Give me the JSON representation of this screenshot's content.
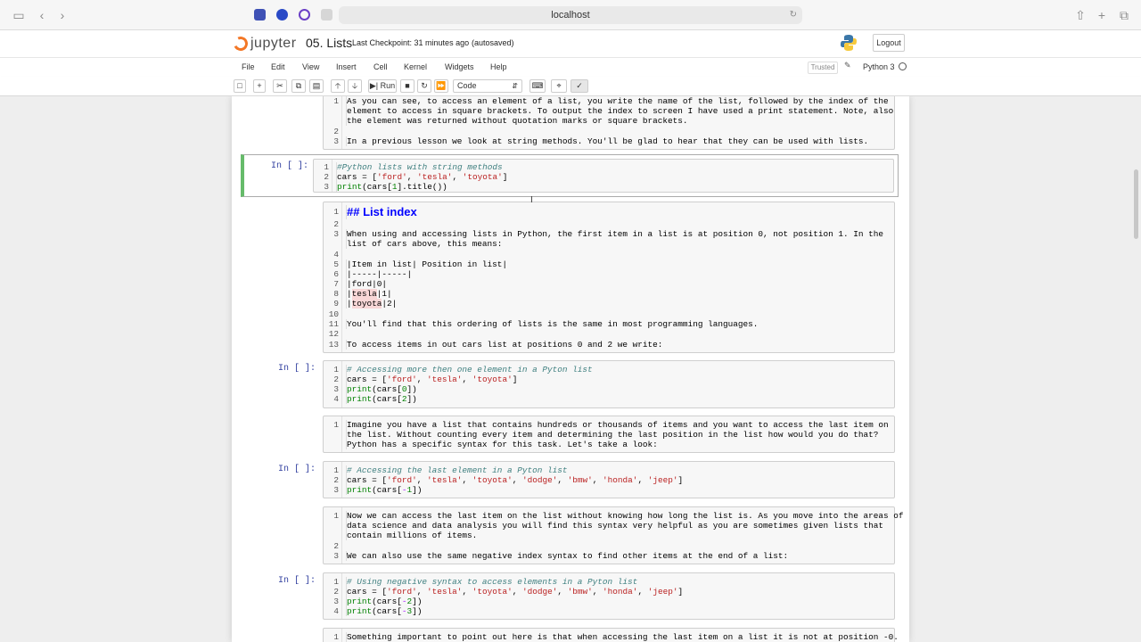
{
  "browser": {
    "url": "localhost"
  },
  "header": {
    "logo_text": "jupyter",
    "notebook_title": "05. Lists",
    "checkpoint": "Last Checkpoint: 31 minutes ago",
    "autosaved": "(autosaved)",
    "logout": "Logout"
  },
  "menubar": {
    "items": [
      "File",
      "Edit",
      "View",
      "Insert",
      "Cell",
      "Kernel",
      "Widgets",
      "Help"
    ],
    "trusted": "Trusted",
    "kernel": "Python 3"
  },
  "toolbar": {
    "run_label": "Run",
    "cell_type": "Code"
  },
  "cells": [
    {
      "type": "markdown",
      "prompt": "",
      "lines": [
        "As you can see, to access an element of a list, you write the name of the list, followed by the index of the",
        "element to access in square brackets. To output the index to screen I have used a print statement. Note, also",
        "the element was returned without quotation marks or square brackets.",
        "",
        "In a previous lesson we look at string methods. You'll be glad to hear that they can be used with lists."
      ],
      "numbers": [
        "1",
        "",
        "",
        "2",
        "3"
      ]
    },
    {
      "type": "code",
      "prompt": "In [ ]:",
      "lines": [
        "#Python lists with string methods",
        "cars = ['ford', 'tesla', 'toyota']",
        "print(cars[1].title())"
      ],
      "numbers": [
        "1",
        "2",
        "3"
      ]
    },
    {
      "type": "markdown",
      "prompt": "",
      "lines": [
        "## List index",
        "",
        "When using and accessing lists in Python, the first item in a list is at position 0, not position 1. In the",
        "list of cars above, this means:",
        "",
        "|Item in list| Position in list|",
        "|-----|-----|",
        "|ford|0|",
        "|tesla|1|",
        "|toyota|2|",
        "",
        "You'll find that this ordering of lists is the same in most programming languages.",
        "",
        "To access items in out cars list at positions 0 and 2 we write:"
      ],
      "numbers": [
        "1",
        "2",
        "3",
        "",
        "4",
        "5",
        "6",
        "7",
        "8",
        "9",
        "10",
        "11",
        "12",
        "13"
      ]
    },
    {
      "type": "code",
      "prompt": "In [ ]:",
      "lines": [
        "# Accessing more then one element in a Pyton list",
        "cars = ['ford', 'tesla', 'toyota']",
        "print(cars[0])",
        "print(cars[2])"
      ],
      "numbers": [
        "1",
        "2",
        "3",
        "4"
      ]
    },
    {
      "type": "markdown",
      "prompt": "",
      "lines": [
        "Imagine you have a list that contains hundreds or thousands of items and you want to access the last item on",
        "the list. Without counting every item and determining the last position in the list how would you do that?",
        "Python has a specific syntax for this task. Let's take a look:"
      ],
      "numbers": [
        "1",
        "",
        ""
      ]
    },
    {
      "type": "code",
      "prompt": "In [ ]:",
      "lines": [
        "# Accessing the last element in a Pyton list",
        "cars = ['ford', 'tesla', 'toyota', 'dodge', 'bmw', 'honda', 'jeep']",
        "print(cars[-1])"
      ],
      "numbers": [
        "1",
        "2",
        "3"
      ]
    },
    {
      "type": "markdown",
      "prompt": "",
      "lines": [
        "Now we can access the last item on the list without knowing how long the list is. As you move into the areas of",
        "data science and data analysis you will find this syntax very helpful as you are sometimes given lists that",
        "contain millions of items.",
        "",
        "We can also use the same negative index syntax to find other items at the end of a list:"
      ],
      "numbers": [
        "1",
        "",
        "",
        "2",
        "3"
      ]
    },
    {
      "type": "code",
      "prompt": "In [ ]:",
      "lines": [
        "# Using negative syntax to access elements in a Pyton list",
        "cars = ['ford', 'tesla', 'toyota', 'dodge', 'bmw', 'honda', 'jeep']",
        "print(cars[-2])",
        "print(cars[-3])"
      ],
      "numbers": [
        "1",
        "2",
        "3",
        "4"
      ]
    },
    {
      "type": "markdown",
      "prompt": "",
      "lines": [
        "Something important to point out here is that when accessing the last item on a list it is not at position -0."
      ],
      "numbers": [
        "1"
      ]
    }
  ]
}
